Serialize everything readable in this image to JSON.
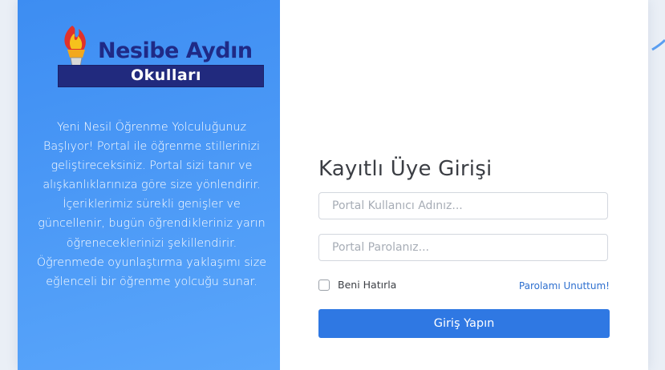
{
  "brand": {
    "title": "Nesibe Aydın",
    "subtitle": "Okulları"
  },
  "intro": {
    "text": "Yeni Nesil Öğrenme Yolculuğunuz Başlıyor! Portal ile öğrenme stillerinizi geliştireceksiniz. Portal sizi tanır ve alışkanlıklarınıza göre size yönlendirir. İçeriklerimiz sürekli genişler ve güncellenir, bugün öğrendikleriniz yarın öğreneceklerinizi şekillendirir. Öğrenmede oyunlaştırma yaklaşımı size eğlenceli bir öğrenme yolcuğu sunar."
  },
  "login": {
    "title": "Kayıtlı Üye Girişi",
    "username_placeholder": "Portal Kullanıcı Adınız...",
    "username_value": "",
    "password_placeholder": "Portal Parolanız...",
    "password_value": "",
    "remember_label": "Beni Hatırla",
    "remember_checked": false,
    "forgot_label": "Parolamı Unuttum!",
    "submit_label": "Giriş Yapın"
  },
  "colors": {
    "left_panel": "#4a98f6",
    "button": "#2f78e3",
    "logo_navy": "#212a7e",
    "link": "#2d6fcf"
  },
  "icons": {
    "logo": "torch-icon"
  }
}
